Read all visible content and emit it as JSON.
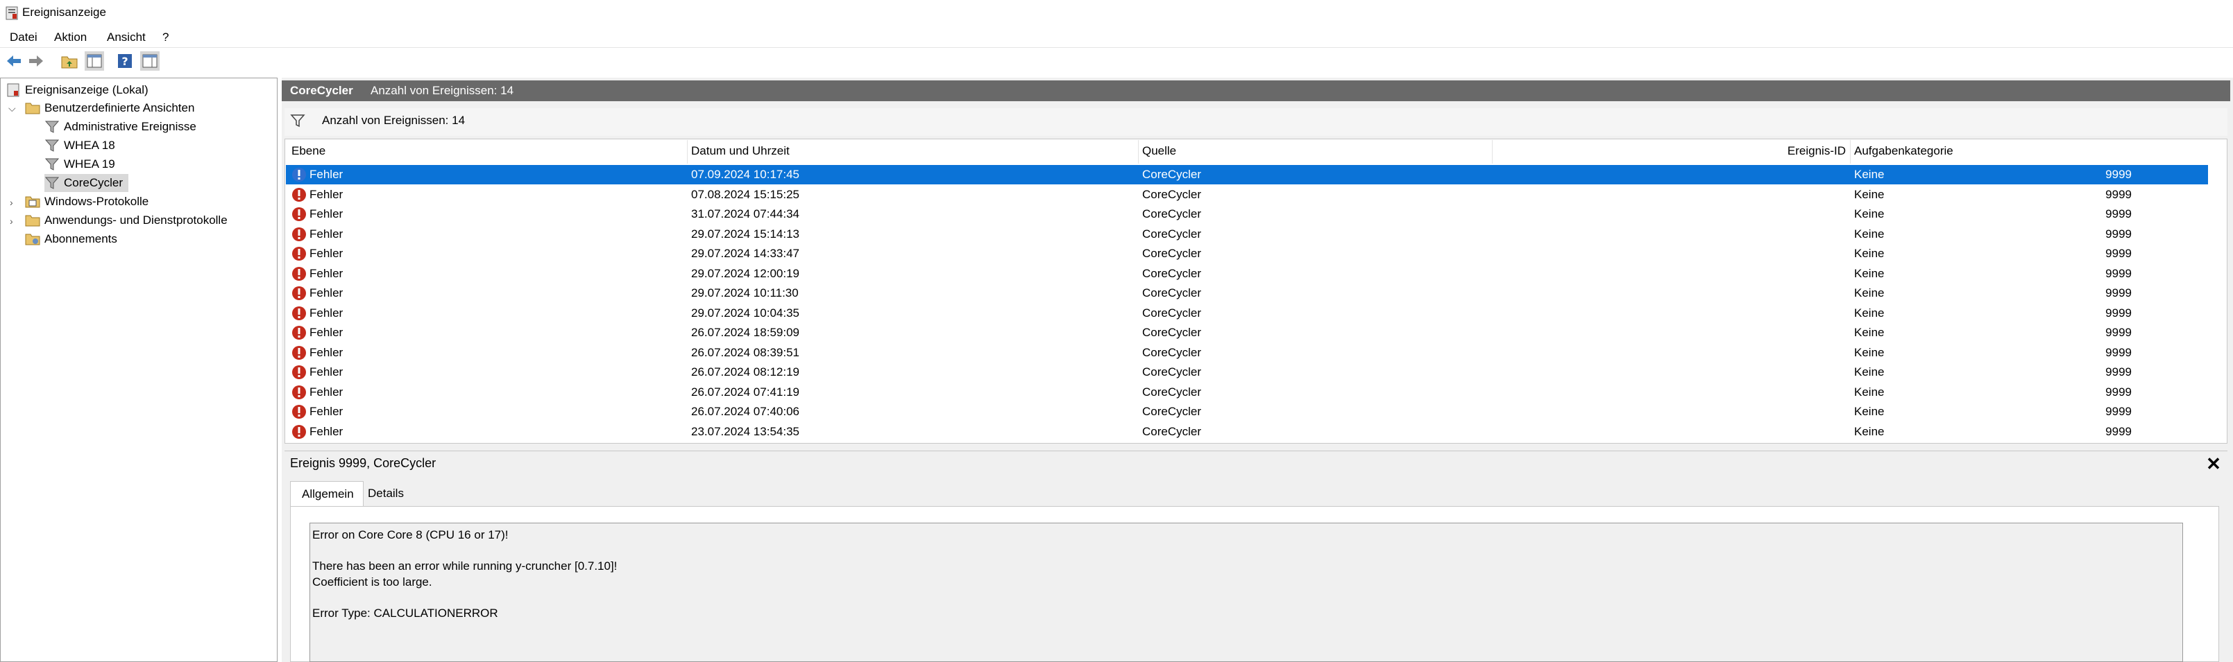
{
  "window": {
    "title": "Ereignisanzeige"
  },
  "menu": [
    "Datei",
    "Aktion",
    "Ansicht",
    "?"
  ],
  "toolbar": {
    "icons": [
      "back-arrow-icon",
      "forward-arrow-icon",
      "folder-up-icon",
      "console-tree-icon",
      "help-icon",
      "properties-icon"
    ]
  },
  "tree": {
    "root": "Ereignisanzeige (Lokal)",
    "custom_views": "Benutzerdefinierte Ansichten",
    "admin_events": "Administrative Ereignisse",
    "whea18": "WHEA 18",
    "whea19": "WHEA 19",
    "corecycler": "CoreCycler",
    "windows_logs": "Windows-Protokolle",
    "app_logs": "Anwendungs- und Dienstprotokolle",
    "subscriptions": "Abonnements"
  },
  "view": {
    "name": "CoreCycler",
    "count_label": "Anzahl von Ereignissen: 14",
    "filter_text": "Anzahl von Ereignissen: 14"
  },
  "columns": {
    "level": "Ebene",
    "datetime": "Datum und Uhrzeit",
    "source": "Quelle",
    "event_id": "Ereignis-ID",
    "task": "Aufgabenkategorie"
  },
  "events": [
    {
      "level": "Fehler",
      "datetime": "07.09.2024 10:17:45",
      "source": "CoreCycler",
      "event_id": "9999",
      "task": "Keine"
    },
    {
      "level": "Fehler",
      "datetime": "07.08.2024 15:15:25",
      "source": "CoreCycler",
      "event_id": "9999",
      "task": "Keine"
    },
    {
      "level": "Fehler",
      "datetime": "31.07.2024 07:44:34",
      "source": "CoreCycler",
      "event_id": "9999",
      "task": "Keine"
    },
    {
      "level": "Fehler",
      "datetime": "29.07.2024 15:14:13",
      "source": "CoreCycler",
      "event_id": "9999",
      "task": "Keine"
    },
    {
      "level": "Fehler",
      "datetime": "29.07.2024 14:33:47",
      "source": "CoreCycler",
      "event_id": "9999",
      "task": "Keine"
    },
    {
      "level": "Fehler",
      "datetime": "29.07.2024 12:00:19",
      "source": "CoreCycler",
      "event_id": "9999",
      "task": "Keine"
    },
    {
      "level": "Fehler",
      "datetime": "29.07.2024 10:11:30",
      "source": "CoreCycler",
      "event_id": "9999",
      "task": "Keine"
    },
    {
      "level": "Fehler",
      "datetime": "29.07.2024 10:04:35",
      "source": "CoreCycler",
      "event_id": "9999",
      "task": "Keine"
    },
    {
      "level": "Fehler",
      "datetime": "26.07.2024 18:59:09",
      "source": "CoreCycler",
      "event_id": "9999",
      "task": "Keine"
    },
    {
      "level": "Fehler",
      "datetime": "26.07.2024 08:39:51",
      "source": "CoreCycler",
      "event_id": "9999",
      "task": "Keine"
    },
    {
      "level": "Fehler",
      "datetime": "26.07.2024 08:12:19",
      "source": "CoreCycler",
      "event_id": "9999",
      "task": "Keine"
    },
    {
      "level": "Fehler",
      "datetime": "26.07.2024 07:41:19",
      "source": "CoreCycler",
      "event_id": "9999",
      "task": "Keine"
    },
    {
      "level": "Fehler",
      "datetime": "26.07.2024 07:40:06",
      "source": "CoreCycler",
      "event_id": "9999",
      "task": "Keine"
    },
    {
      "level": "Fehler",
      "datetime": "23.07.2024 13:54:35",
      "source": "CoreCycler",
      "event_id": "9999",
      "task": "Keine"
    }
  ],
  "detail": {
    "title": "Ereignis 9999, CoreCycler",
    "close": "✕",
    "tabs": {
      "general": "Allgemein",
      "details": "Details"
    },
    "lines": [
      "Error on Core Core 8 (CPU 16 or 17)!",
      "There has been an error while running y-cruncher [0.7.10]!",
      "Coefficient is too large.",
      "Error Type: CALCULATIONERROR"
    ]
  },
  "colors": {
    "selection": "#0b73d7",
    "header_bar": "#696969",
    "error_red": "#c42b1c"
  }
}
